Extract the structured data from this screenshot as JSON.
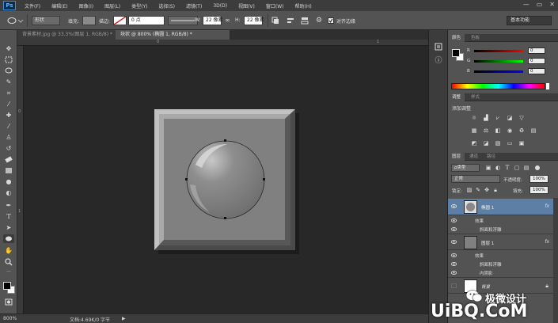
{
  "menu": {
    "logo": "Ps",
    "items": [
      "文件(F)",
      "编辑(E)",
      "图像(I)",
      "图层(L)",
      "类型(Y)",
      "选择(S)",
      "滤镜(T)",
      "3D(D)",
      "视图(V)",
      "窗口(W)",
      "帮助(H)"
    ],
    "window_controls": [
      "—",
      "▭",
      "✕"
    ]
  },
  "options": {
    "tool_mode": "形状",
    "fill_label": "填充:",
    "stroke_label": "描边:",
    "stroke_width": "0 点",
    "w_label": "W:",
    "w_value": "22 像素",
    "h_label": "H:",
    "h_value": "22 像素",
    "align_edges": "对齐边缘",
    "workspace": "基本功能"
  },
  "tabs": [
    {
      "label": "背景素材.jpg @ 33.3%(图层 1, RGB/8) *",
      "active": false
    },
    {
      "label": "块状 @ 800% (椭圆 1, RGB/8) *",
      "active": true
    }
  ],
  "ruler": {
    "top_ticks": [
      "0",
      "1"
    ],
    "left_ticks": [
      "0",
      "1"
    ]
  },
  "status": {
    "zoom": "800%",
    "doc_info": "文档:4.69K/0 字节"
  },
  "color_panel": {
    "tabs": [
      "颜色",
      "色板"
    ],
    "channels": [
      {
        "label": "R",
        "value": "0"
      },
      {
        "label": "G",
        "value": "0"
      },
      {
        "label": "B",
        "value": "0"
      }
    ]
  },
  "adjust_panel": {
    "tabs": [
      "调整",
      "样式"
    ],
    "title": "添加调整"
  },
  "layers_panel": {
    "tabs": [
      "图层",
      "通道",
      "路径"
    ],
    "filter": "ρ类型",
    "blend_mode": "正常",
    "opacity_label": "不透明度:",
    "opacity": "100%",
    "lock_label": "锁定:",
    "fill_label": "填充:",
    "fill": "100%",
    "layers": [
      {
        "name": "椭圆 1",
        "selected": true,
        "fx": "fx",
        "effects_label": "效果",
        "effects": [
          "斜面和浮雕"
        ]
      },
      {
        "name": "图层 1",
        "selected": false,
        "fx": "fx",
        "effects_label": "效果",
        "effects": [
          "斜面和浮雕",
          "内阴影"
        ]
      },
      {
        "name": "背景",
        "selected": false,
        "fx": "",
        "effects_label": "",
        "effects": []
      }
    ]
  },
  "watermark": {
    "brand": "极微设计",
    "site": "UiBQ.CoM"
  },
  "colors": {
    "accent": "#5d7fa6",
    "panel": "#535353",
    "canvas": "#282828"
  }
}
